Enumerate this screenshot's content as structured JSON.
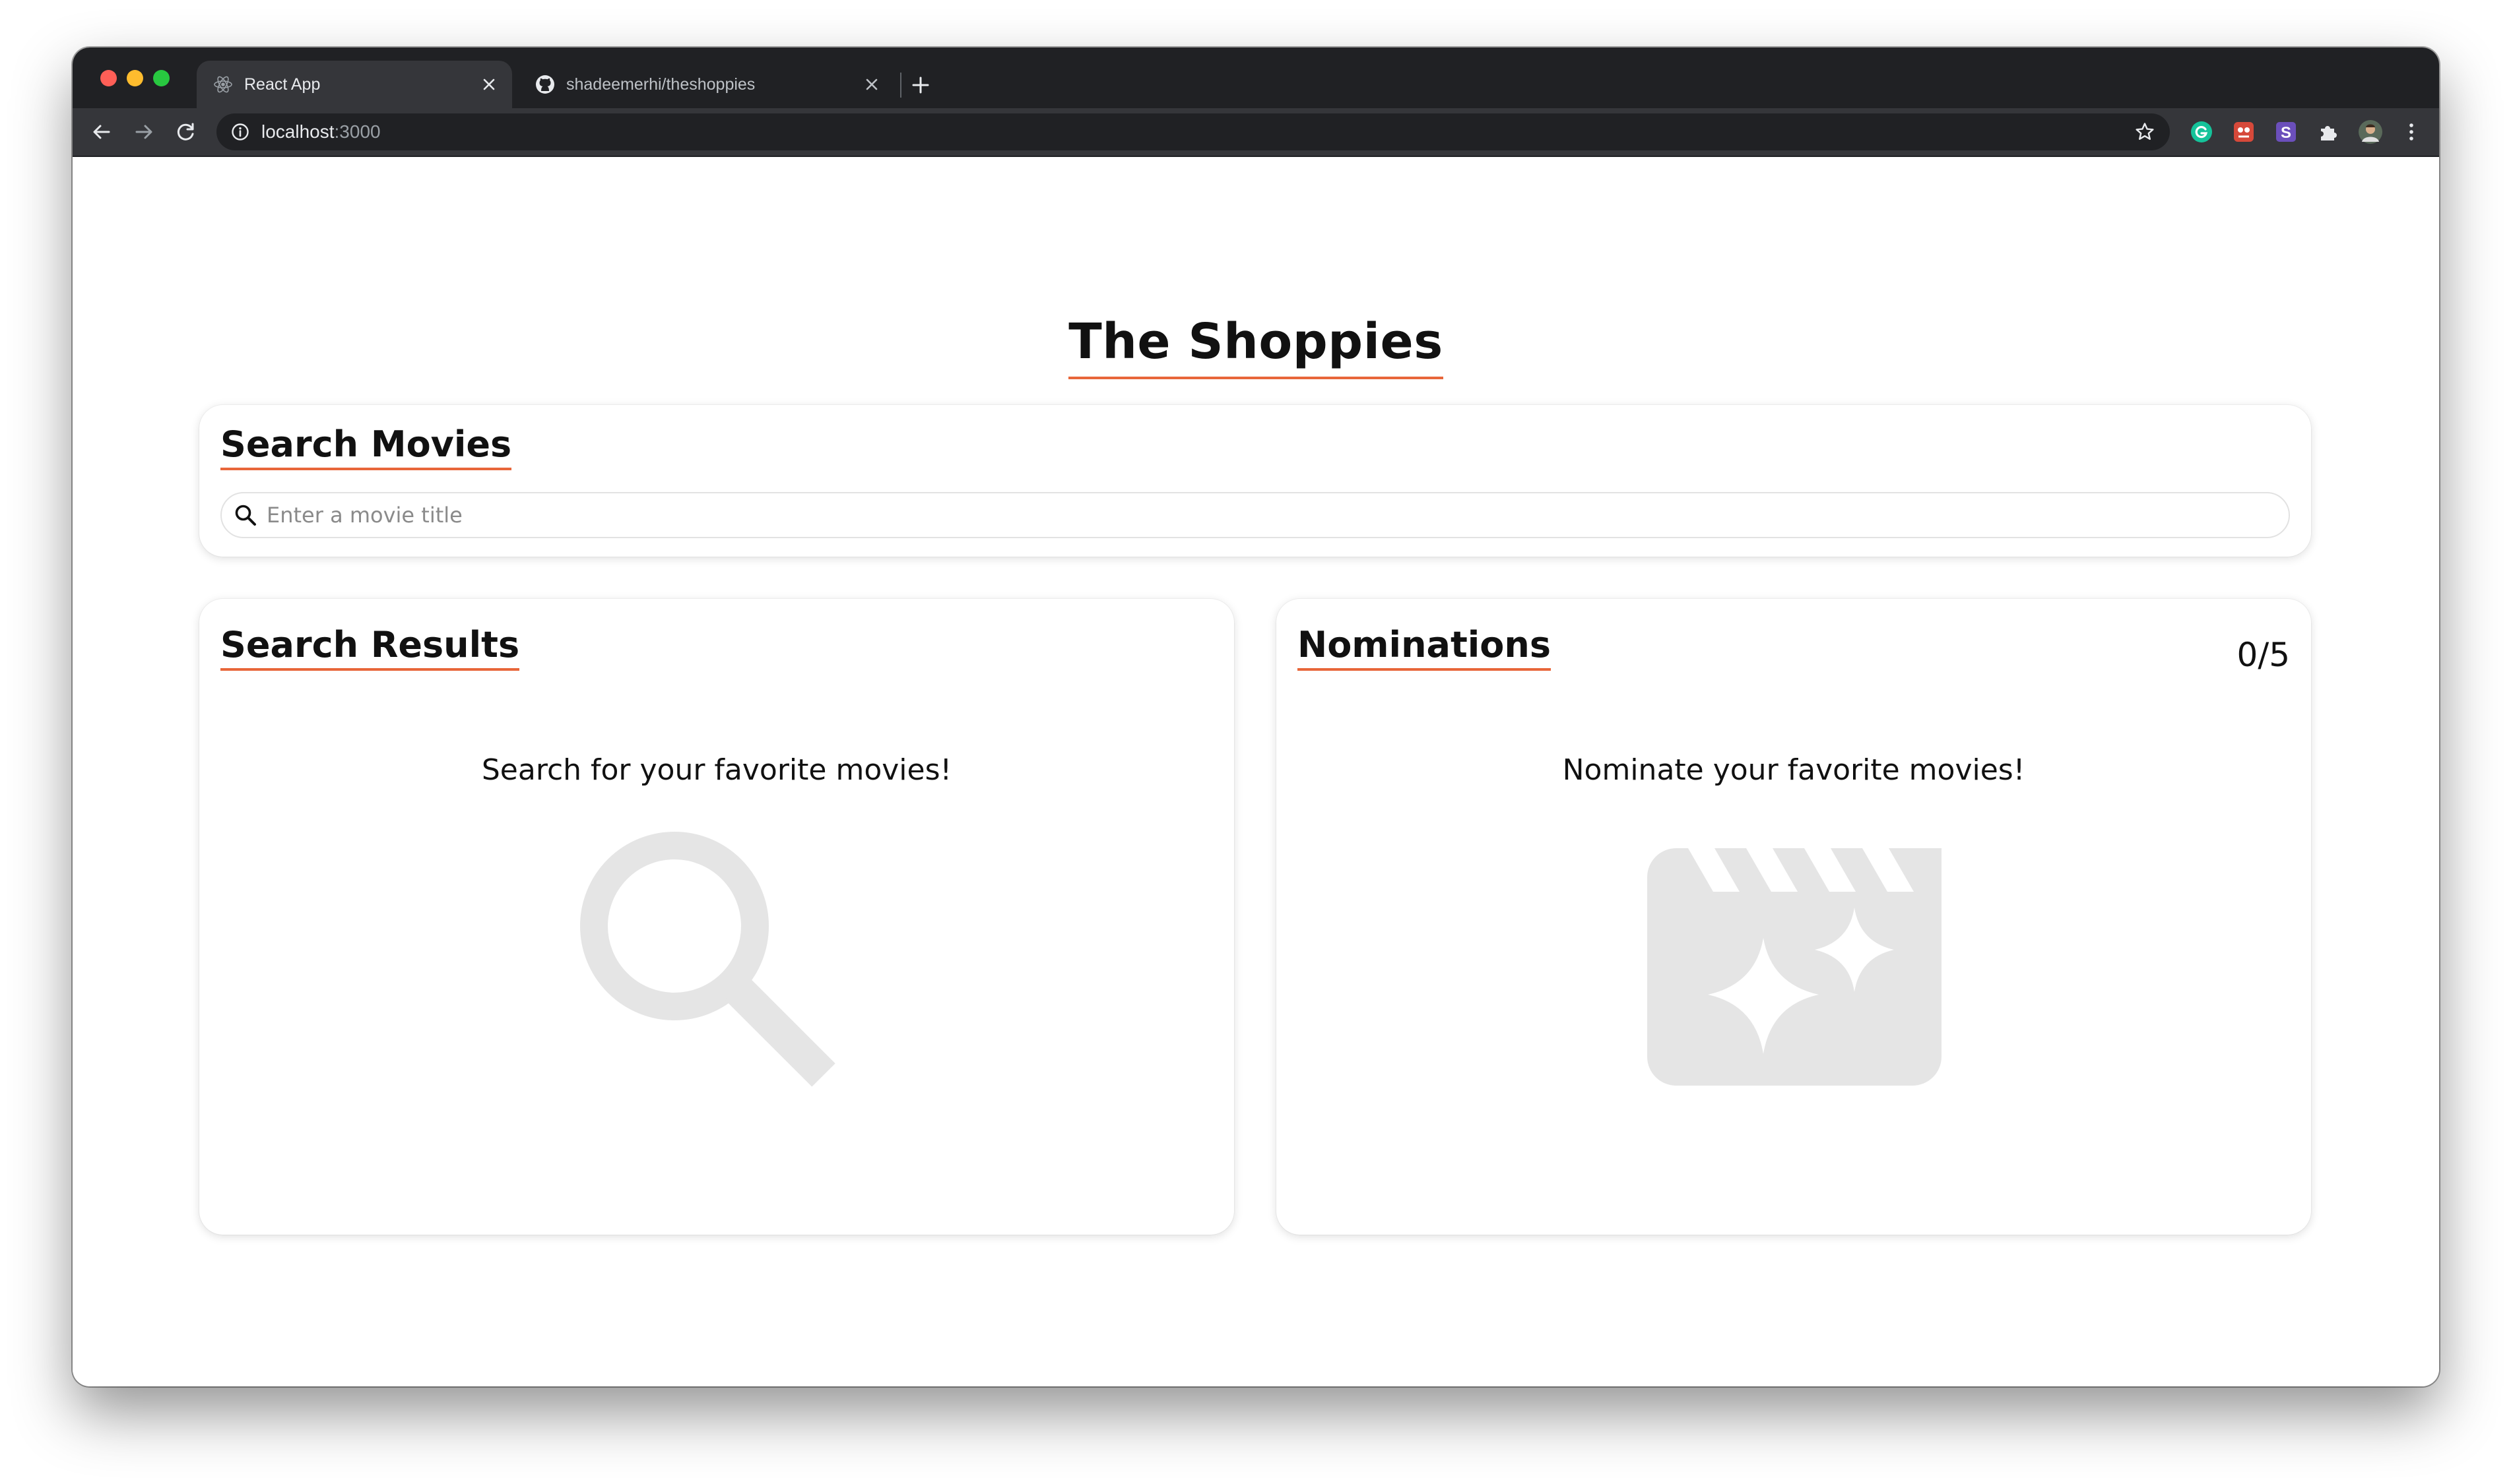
{
  "browser": {
    "tabs": [
      {
        "title": "React App",
        "favicon": "react-icon",
        "active": true
      },
      {
        "title": "shadeemerhi/theshoppies",
        "favicon": "github-icon",
        "active": false
      }
    ],
    "url": {
      "host": "localhost",
      "port": ":3000"
    },
    "extensions": [
      "grammarly-icon",
      "extension-red-icon",
      "extension-s-icon",
      "puzzle-icon",
      "profile-avatar"
    ],
    "colors": {
      "frame": "#202124",
      "toolbar": "#35363a",
      "accent": "#e8663a"
    }
  },
  "page": {
    "title": "The Shoppies",
    "search": {
      "heading": "Search Movies",
      "placeholder": "Enter a movie title",
      "value": ""
    },
    "results": {
      "heading": "Search Results",
      "empty_message": "Search for your favorite movies!",
      "illustration": "magnifier-illustration"
    },
    "nominations": {
      "heading": "Nominations",
      "count": "0/5",
      "empty_message": "Nominate your favorite movies!",
      "illustration": "clapperboard-stars-illustration"
    }
  }
}
